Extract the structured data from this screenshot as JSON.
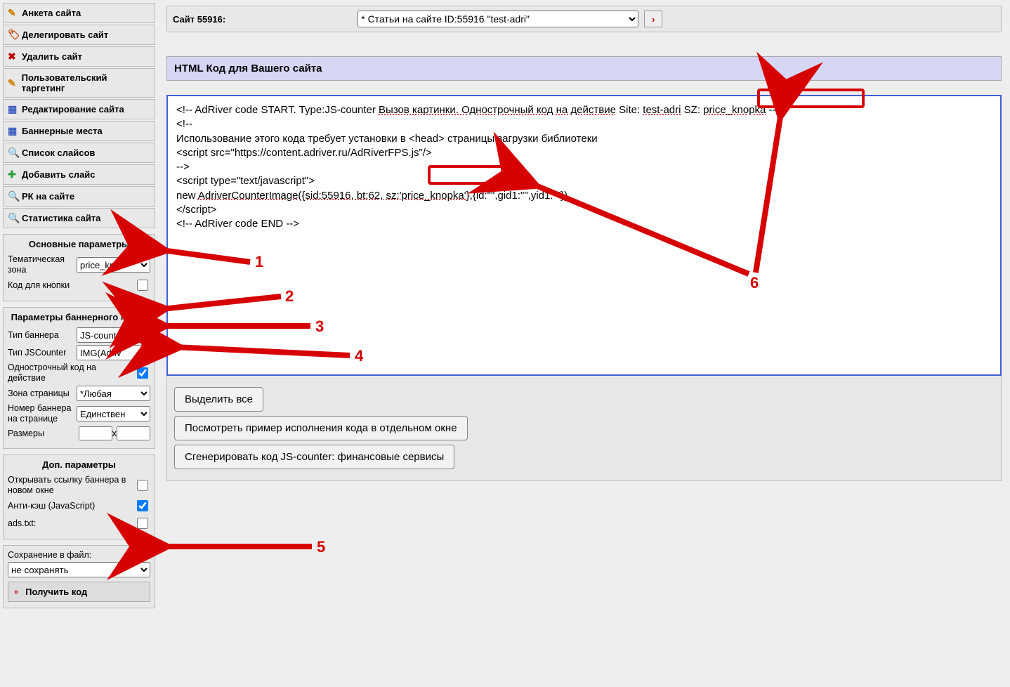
{
  "sidebar": {
    "menu": [
      {
        "icon": "✎",
        "label": "Анкета сайта",
        "iconColor": "#d08000"
      },
      {
        "icon": "🏷",
        "label": "Делегировать сайт",
        "iconColor": "#c04000"
      },
      {
        "icon": "✖",
        "label": "Удалить сайт",
        "iconColor": "#c00000"
      },
      {
        "icon": "✎",
        "label": "Пользовательский таргетинг",
        "iconColor": "#d08000"
      },
      {
        "icon": "▦",
        "label": "Редактирование сайта",
        "iconColor": "#4060c0"
      },
      {
        "icon": "▦",
        "label": "Баннерные места",
        "iconColor": "#4060c0"
      },
      {
        "icon": "🔍",
        "label": "Список слайсов",
        "iconColor": "#3060a0"
      },
      {
        "icon": "✚",
        "label": "Добавить слайс",
        "iconColor": "#30a040"
      },
      {
        "icon": "🔍",
        "label": "РК на сайте",
        "iconColor": "#3060a0"
      },
      {
        "icon": "🔍",
        "label": "Статистика сайта",
        "iconColor": "#3060a0"
      }
    ]
  },
  "params": {
    "main_title": "Основные параметры",
    "theme_zone_label": "Тематическая зона",
    "theme_zone_value": "price_kno",
    "button_code_label": "Код для кнопки",
    "button_code_checked": false,
    "banner_title": "Параметры баннерного места",
    "banner_type_label": "Тип баннера",
    "banner_type_value": "JS-counte",
    "jscounter_type_label": "Тип JSCounter",
    "jscounter_type_value": "IMG(Adriv",
    "oneline_label": "Однострочный код на действие",
    "oneline_checked": true,
    "page_zone_label": "Зона страницы",
    "page_zone_value": "*Любая",
    "banner_num_label": "Номер баннера на странице",
    "banner_num_value": "Единствен",
    "sizes_label": "Размеры",
    "size_sep": "х",
    "extra_title": "Доп. параметры",
    "open_new_label": "Открывать ссылку баннера в новом окне",
    "open_new_checked": false,
    "anticache_label": "Анти-кэш (JavaScript)",
    "anticache_checked": true,
    "adstxt_label": "ads.txt:",
    "adstxt_checked": false,
    "save_file_label": "Сохранение в файл:",
    "save_file_value": "не сохранять",
    "get_code_label": "Получить код"
  },
  "topbar": {
    "site_label": "Сайт 55916:",
    "select_value": "* Статьи на сайте ID:55916    \"test-adri\"",
    "go_glyph": "›"
  },
  "code": {
    "header": "HTML Код для Вашего сайта",
    "l1a": "<!--  AdRiver code START. Type:JS-counter ",
    "l1b": "Вызов картинки. Однострочный код на действие",
    "l1c": " Site: ",
    "l1d": "test-adri",
    "l1e": " SZ: ",
    "l1f": "price_knopka",
    "l1g": "  -->",
    "l2": "<!--",
    "l3": "Использование этого кода требует установки в <head> страницы загрузки библиотеки",
    "l4": "<script src=\"https://content.adriver.ru/AdRiverFPS.js\"/>",
    "l5": "-->",
    "l6": "<script type=\"text/javascript\">",
    "l7a": "new ",
    "l7b": "AdriverCounterImage({sid:55916, bt:62, ",
    "l7c": "sz:'price_knopka'",
    "l7d": "},{id:\"\",gid1:\"\",yid1:\"\"})",
    "l8": "</script>",
    "l9": "<!--  AdRiver code END  -->"
  },
  "actions": {
    "select_all": "Выделить все",
    "preview": "Посмотреть пример исполнения кода в отдельном окне",
    "generate": "Сгенерировать код JS-counter: финансовые сервисы"
  },
  "annotations": {
    "n1": "1",
    "n2": "2",
    "n3": "3",
    "n4": "4",
    "n5": "5",
    "n6": "6"
  }
}
